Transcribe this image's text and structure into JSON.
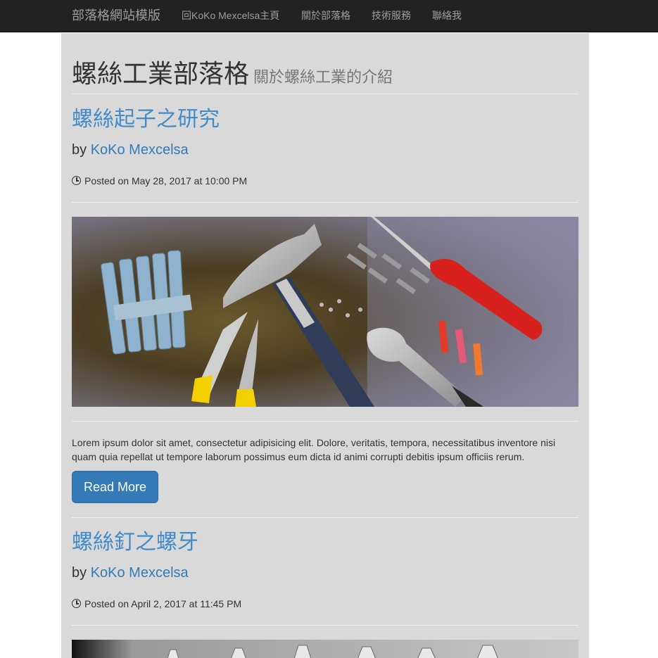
{
  "navbar": {
    "brand": "部落格網站模版",
    "links": [
      "回KoKo Mexcelsa主頁",
      "關於部落格",
      "技術服務",
      "聯絡我"
    ]
  },
  "header": {
    "title": "螺絲工業部落格",
    "subtitle": "關於螺絲工業的介紹"
  },
  "posts": [
    {
      "title": "螺絲起子之研究",
      "by": "by",
      "author": "KoKo Mexcelsa",
      "posted": "Posted on May 28, 2017 at 10:00 PM",
      "excerpt": "Lorem ipsum dolor sit amet, consectetur adipisicing elit. Dolore, veritatis, tempora, necessitatibus inventore nisi quam quia repellat ut tempore laborum possimus eum dicta id animi corrupti debitis ipsum officiis rerum.",
      "button": "Read More"
    },
    {
      "title": "螺絲釘之螺牙",
      "by": "by",
      "author": "KoKo Mexcelsa",
      "posted": "Posted on April 2, 2017 at 11:45 PM"
    }
  ],
  "colors": {
    "navbar": "#222222",
    "content_bg": "#d9d9d9",
    "link": "#337ab7",
    "button": "#337ab7"
  }
}
